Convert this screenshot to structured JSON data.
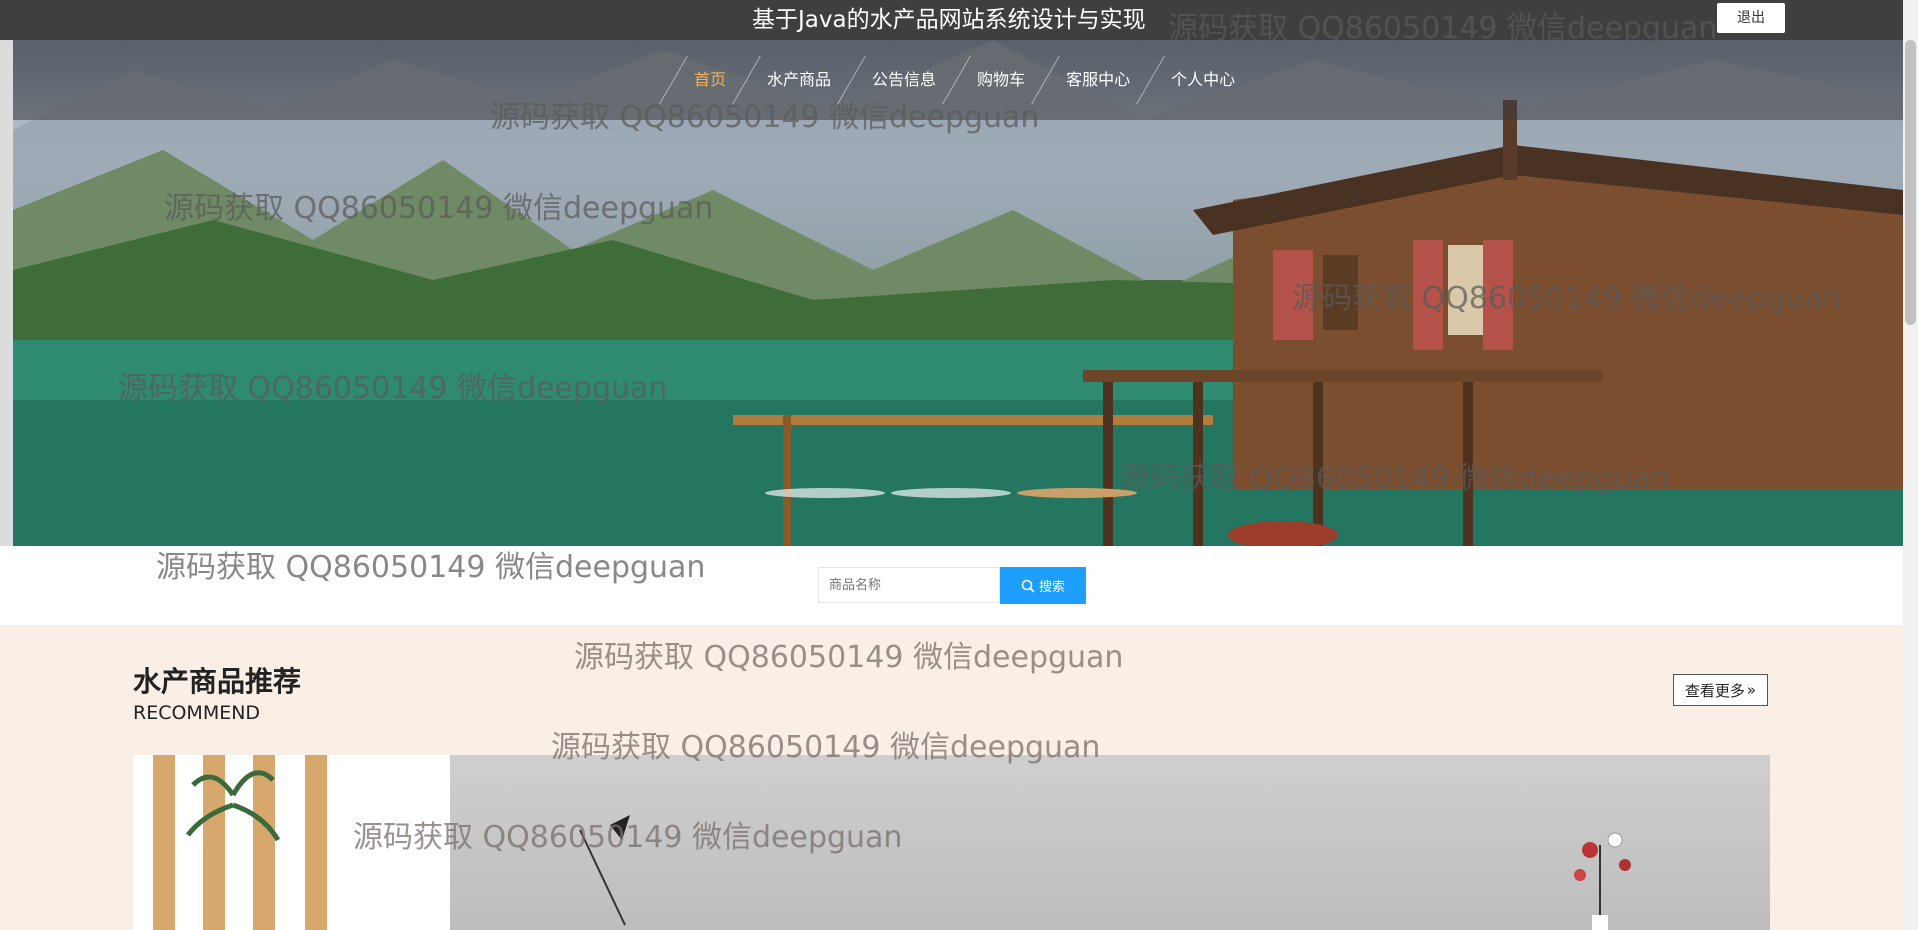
{
  "header": {
    "site_title": "基于Java的水产品网站系统设计与实现",
    "logout_label": "退出"
  },
  "nav": {
    "items": [
      "首页",
      "水产商品",
      "公告信息",
      "购物车",
      "客服中心",
      "个人中心"
    ],
    "active_index": 0
  },
  "banner": {
    "slide_count": 3,
    "active_slide": 2
  },
  "search": {
    "placeholder": "商品名称",
    "button_label": "搜索"
  },
  "recommend": {
    "title": "水产商品推荐",
    "subtitle": "RECOMMEND",
    "more_label": "查看更多"
  },
  "watermark": {
    "text": "源码获取 QQ86050149 微信deepguan"
  },
  "colors": {
    "topbar": "#3f3f3f",
    "nav_active": "#f0b35a",
    "search_button": "#1e9fff",
    "section_bg": "#f9efe6"
  }
}
